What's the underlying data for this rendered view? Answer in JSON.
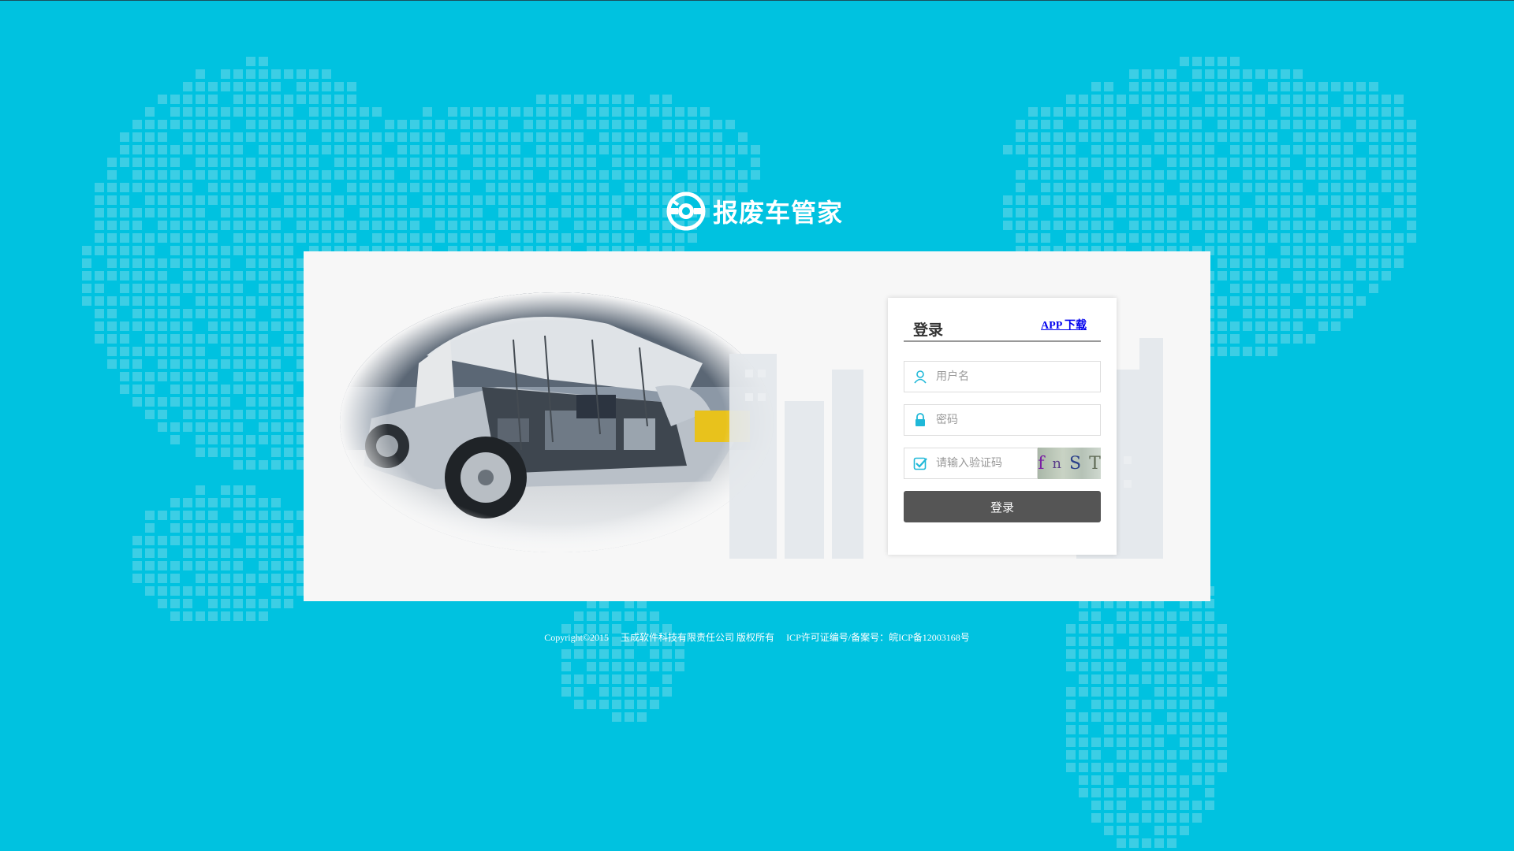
{
  "header": {
    "logo_text": "报废车管家",
    "logo_icon": "car-wrench-icon"
  },
  "login": {
    "title": "登录",
    "app_download": "APP 下载",
    "username_placeholder": "用户名",
    "password_placeholder": "密码",
    "captcha_placeholder": "请输入验证码",
    "captcha_text": [
      "f",
      "n",
      "S",
      "T"
    ],
    "submit_label": "登录"
  },
  "footer": {
    "copyright": "Copyright©2015",
    "company": "玉成软件科技有限责任公司 版权所有",
    "icp": "ICP许可证编号/备案号：皖ICP备12003168号"
  },
  "colors": {
    "background": "#00c2e0",
    "button": "#555555",
    "icon_accent": "#1fb8d8",
    "link": "#0000ee"
  }
}
